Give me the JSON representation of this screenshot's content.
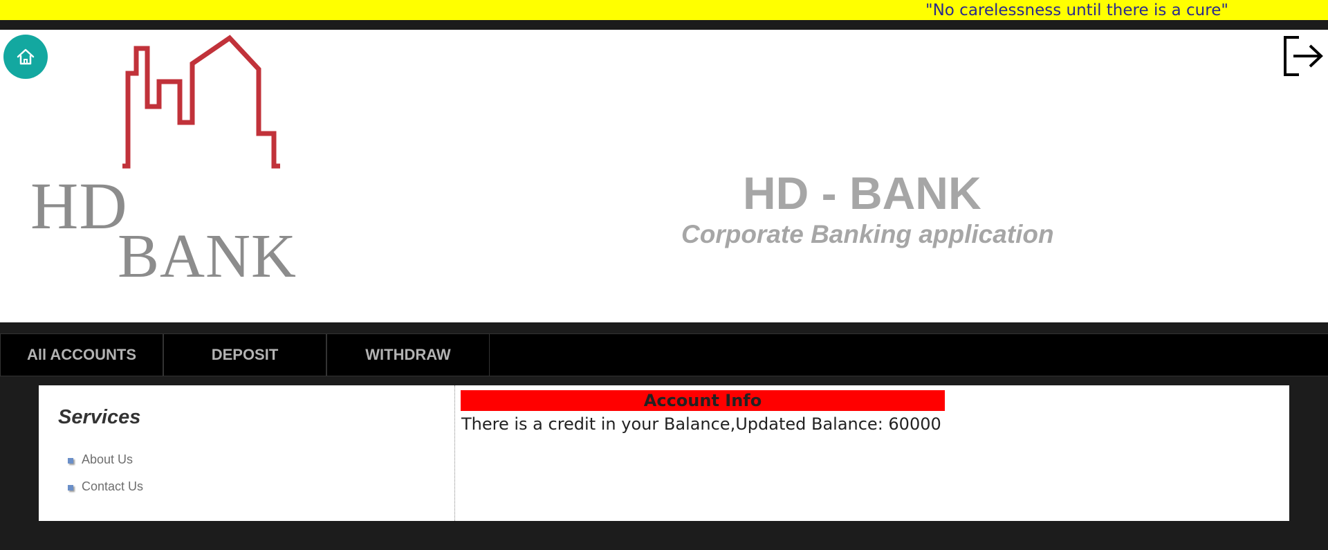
{
  "ticker": {
    "text": "\"No carelessness until there is a cure\""
  },
  "header": {
    "home_icon": "home-icon",
    "logout_icon": "logout-icon",
    "logo": {
      "line1": "HD",
      "line2": "BANK",
      "color": "#c1323a"
    },
    "title": "HD - BANK",
    "subtitle": "Corporate Banking application"
  },
  "nav": {
    "items": [
      {
        "label": "All ACCOUNTS"
      },
      {
        "label": "DEPOSIT"
      },
      {
        "label": "WITHDRAW"
      }
    ]
  },
  "services": {
    "title": "Services",
    "links": [
      {
        "label": "About Us"
      },
      {
        "label": "Contact Us"
      }
    ]
  },
  "account_info": {
    "header": "Account Info",
    "message": "There is a credit in your Balance,Updated Balance: 60000",
    "header_color": "#ff0000"
  },
  "colors": {
    "ticker_bg": "#ffff00",
    "home_button": "#13a8a0",
    "page_bg": "#1c1c1c"
  }
}
